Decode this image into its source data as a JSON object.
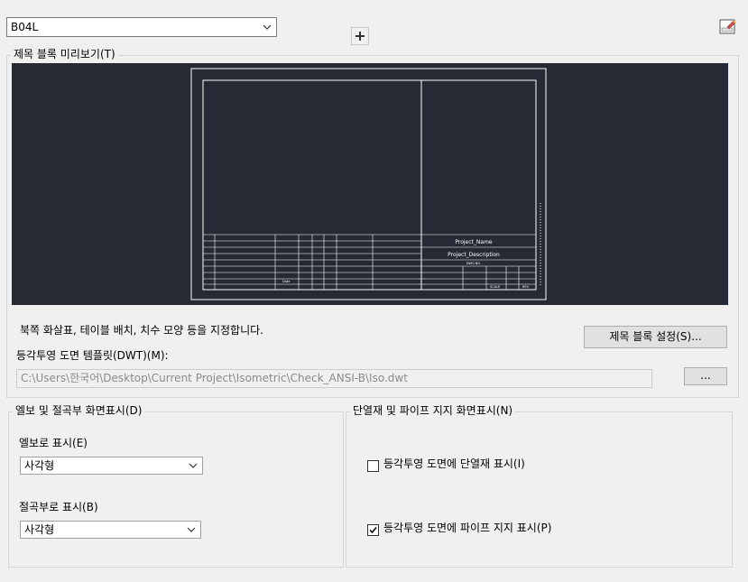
{
  "top": {
    "block_select_value": "B04L"
  },
  "preview": {
    "title": "제목 블록 미리보기(T)",
    "title_block": {
      "project_name": "Project_Name",
      "project_description": "Project_Description",
      "drawing_number": "DWG NO.",
      "date_label": "Date",
      "scale_label": "SCALE",
      "rev_label": "REV"
    }
  },
  "title_block_settings": {
    "description": "북쪽 화살표, 테이블 배치, 치수 모양 등을 지정합니다.",
    "button_label": "제목 블록 설정(S)..."
  },
  "template": {
    "label": "등각투영 도면 템플릿(DWT)(M):",
    "path": "C:\\Users\\한국어\\Desktop\\Current Project\\Isometric\\Check_ANSI-B\\Iso.dwt",
    "browse_label": "..."
  },
  "elbow_group": {
    "title": "엘보 및 절곡부 화면표시(D)",
    "elbow_label": "엘보로 표시(E)",
    "elbow_value": "사각형",
    "bend_label": "절곡부로 표시(B)",
    "bend_value": "사각형"
  },
  "insulation_group": {
    "title": "단열재 및 파이프 지지 화면표시(N)",
    "insulation_label": "등각투영 도면에 단열재 표시(I)",
    "insulation_checked": false,
    "support_label": "등각투영 도면에 파이프 지지 표시(P)",
    "support_checked": true
  }
}
